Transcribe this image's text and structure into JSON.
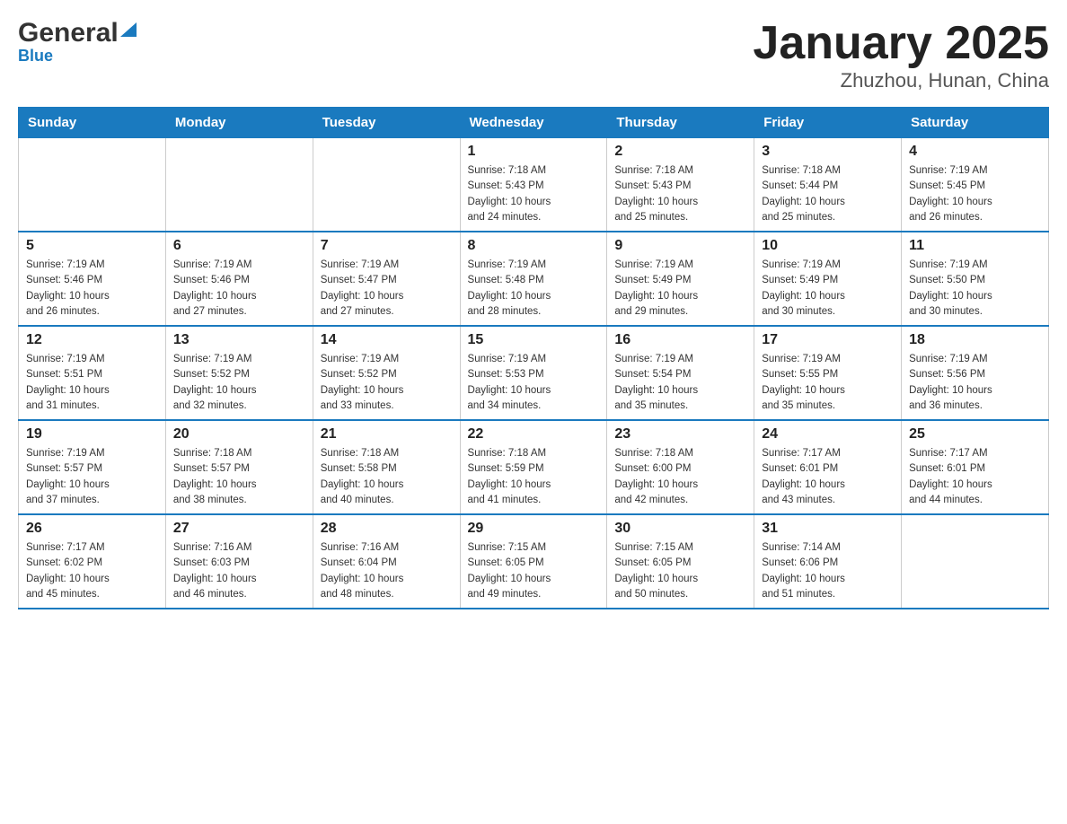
{
  "header": {
    "logo_general": "General",
    "logo_blue": "Blue",
    "title": "January 2025",
    "subtitle": "Zhuzhou, Hunan, China"
  },
  "calendar": {
    "days_of_week": [
      "Sunday",
      "Monday",
      "Tuesday",
      "Wednesday",
      "Thursday",
      "Friday",
      "Saturday"
    ],
    "weeks": [
      [
        {
          "day": "",
          "info": ""
        },
        {
          "day": "",
          "info": ""
        },
        {
          "day": "",
          "info": ""
        },
        {
          "day": "1",
          "info": "Sunrise: 7:18 AM\nSunset: 5:43 PM\nDaylight: 10 hours\nand 24 minutes."
        },
        {
          "day": "2",
          "info": "Sunrise: 7:18 AM\nSunset: 5:43 PM\nDaylight: 10 hours\nand 25 minutes."
        },
        {
          "day": "3",
          "info": "Sunrise: 7:18 AM\nSunset: 5:44 PM\nDaylight: 10 hours\nand 25 minutes."
        },
        {
          "day": "4",
          "info": "Sunrise: 7:19 AM\nSunset: 5:45 PM\nDaylight: 10 hours\nand 26 minutes."
        }
      ],
      [
        {
          "day": "5",
          "info": "Sunrise: 7:19 AM\nSunset: 5:46 PM\nDaylight: 10 hours\nand 26 minutes."
        },
        {
          "day": "6",
          "info": "Sunrise: 7:19 AM\nSunset: 5:46 PM\nDaylight: 10 hours\nand 27 minutes."
        },
        {
          "day": "7",
          "info": "Sunrise: 7:19 AM\nSunset: 5:47 PM\nDaylight: 10 hours\nand 27 minutes."
        },
        {
          "day": "8",
          "info": "Sunrise: 7:19 AM\nSunset: 5:48 PM\nDaylight: 10 hours\nand 28 minutes."
        },
        {
          "day": "9",
          "info": "Sunrise: 7:19 AM\nSunset: 5:49 PM\nDaylight: 10 hours\nand 29 minutes."
        },
        {
          "day": "10",
          "info": "Sunrise: 7:19 AM\nSunset: 5:49 PM\nDaylight: 10 hours\nand 30 minutes."
        },
        {
          "day": "11",
          "info": "Sunrise: 7:19 AM\nSunset: 5:50 PM\nDaylight: 10 hours\nand 30 minutes."
        }
      ],
      [
        {
          "day": "12",
          "info": "Sunrise: 7:19 AM\nSunset: 5:51 PM\nDaylight: 10 hours\nand 31 minutes."
        },
        {
          "day": "13",
          "info": "Sunrise: 7:19 AM\nSunset: 5:52 PM\nDaylight: 10 hours\nand 32 minutes."
        },
        {
          "day": "14",
          "info": "Sunrise: 7:19 AM\nSunset: 5:52 PM\nDaylight: 10 hours\nand 33 minutes."
        },
        {
          "day": "15",
          "info": "Sunrise: 7:19 AM\nSunset: 5:53 PM\nDaylight: 10 hours\nand 34 minutes."
        },
        {
          "day": "16",
          "info": "Sunrise: 7:19 AM\nSunset: 5:54 PM\nDaylight: 10 hours\nand 35 minutes."
        },
        {
          "day": "17",
          "info": "Sunrise: 7:19 AM\nSunset: 5:55 PM\nDaylight: 10 hours\nand 35 minutes."
        },
        {
          "day": "18",
          "info": "Sunrise: 7:19 AM\nSunset: 5:56 PM\nDaylight: 10 hours\nand 36 minutes."
        }
      ],
      [
        {
          "day": "19",
          "info": "Sunrise: 7:19 AM\nSunset: 5:57 PM\nDaylight: 10 hours\nand 37 minutes."
        },
        {
          "day": "20",
          "info": "Sunrise: 7:18 AM\nSunset: 5:57 PM\nDaylight: 10 hours\nand 38 minutes."
        },
        {
          "day": "21",
          "info": "Sunrise: 7:18 AM\nSunset: 5:58 PM\nDaylight: 10 hours\nand 40 minutes."
        },
        {
          "day": "22",
          "info": "Sunrise: 7:18 AM\nSunset: 5:59 PM\nDaylight: 10 hours\nand 41 minutes."
        },
        {
          "day": "23",
          "info": "Sunrise: 7:18 AM\nSunset: 6:00 PM\nDaylight: 10 hours\nand 42 minutes."
        },
        {
          "day": "24",
          "info": "Sunrise: 7:17 AM\nSunset: 6:01 PM\nDaylight: 10 hours\nand 43 minutes."
        },
        {
          "day": "25",
          "info": "Sunrise: 7:17 AM\nSunset: 6:01 PM\nDaylight: 10 hours\nand 44 minutes."
        }
      ],
      [
        {
          "day": "26",
          "info": "Sunrise: 7:17 AM\nSunset: 6:02 PM\nDaylight: 10 hours\nand 45 minutes."
        },
        {
          "day": "27",
          "info": "Sunrise: 7:16 AM\nSunset: 6:03 PM\nDaylight: 10 hours\nand 46 minutes."
        },
        {
          "day": "28",
          "info": "Sunrise: 7:16 AM\nSunset: 6:04 PM\nDaylight: 10 hours\nand 48 minutes."
        },
        {
          "day": "29",
          "info": "Sunrise: 7:15 AM\nSunset: 6:05 PM\nDaylight: 10 hours\nand 49 minutes."
        },
        {
          "day": "30",
          "info": "Sunrise: 7:15 AM\nSunset: 6:05 PM\nDaylight: 10 hours\nand 50 minutes."
        },
        {
          "day": "31",
          "info": "Sunrise: 7:14 AM\nSunset: 6:06 PM\nDaylight: 10 hours\nand 51 minutes."
        },
        {
          "day": "",
          "info": ""
        }
      ]
    ]
  }
}
